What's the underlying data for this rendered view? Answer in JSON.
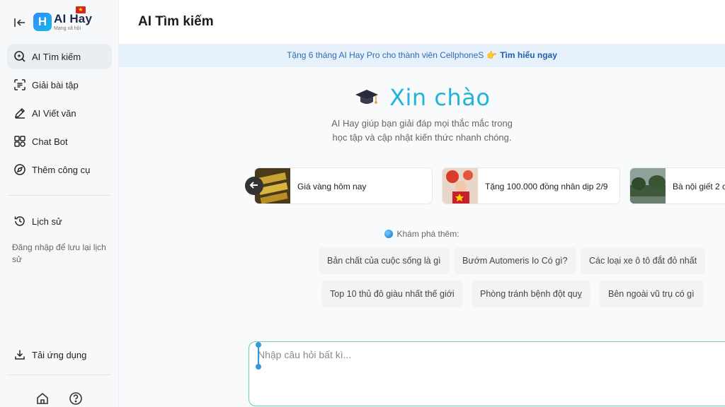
{
  "brand": {
    "name": "AI Hay",
    "tagline": "Mạng xã hội"
  },
  "sidebar": {
    "items": [
      {
        "label": "AI Tìm kiếm",
        "icon": "search-ai-icon",
        "active": true
      },
      {
        "label": "Giải bài tập",
        "icon": "scan-text-icon"
      },
      {
        "label": "AI Viết văn",
        "icon": "pen-ruler-icon"
      },
      {
        "label": "Chat Bot",
        "icon": "grid-bot-icon"
      },
      {
        "label": "Thêm công cụ",
        "icon": "compass-icon"
      }
    ],
    "history_label": "Lịch sử",
    "history_note": "Đăng nhập để lưu lại lịch sử",
    "download_label": "Tải ứng dụng"
  },
  "header": {
    "title": "AI Tìm kiếm"
  },
  "promo": {
    "text": "Tặng 6 tháng AI Hay Pro cho thành viên CellphoneS",
    "link": "Tìm hiểu ngay"
  },
  "greeting": {
    "title": "Xin chào",
    "subtitle_line1": "AI Hay giúp bạn giải đáp mọi thắc mắc trong",
    "subtitle_line2": "học tập và cập nhật kiến thức nhanh chóng."
  },
  "cards": [
    {
      "label": "Giá vàng hôm nay"
    },
    {
      "label": "Tặng 100.000 đồng nhân dịp 2/9"
    },
    {
      "label": "Bà nội giết 2 c"
    }
  ],
  "explore": {
    "label": "Khám phá thêm:",
    "chips": [
      "Bản chất của cuộc sống là gì",
      "Bướm Automeris Io Có gì?",
      "Các loại xe ô tô đắt đỏ nhất",
      "Top 10 thủ đô giàu nhất thế giới",
      "Phòng tránh bệnh đột quỵ",
      "Bên ngoài vũ trụ có gì"
    ]
  },
  "input": {
    "placeholder": "Nhập câu hỏi bất kì..."
  },
  "colors": {
    "accent": "#1fb5d9",
    "promo_bg": "#e6f1fb",
    "input_border": "#6fcfa1",
    "flag_red": "#da251d"
  }
}
